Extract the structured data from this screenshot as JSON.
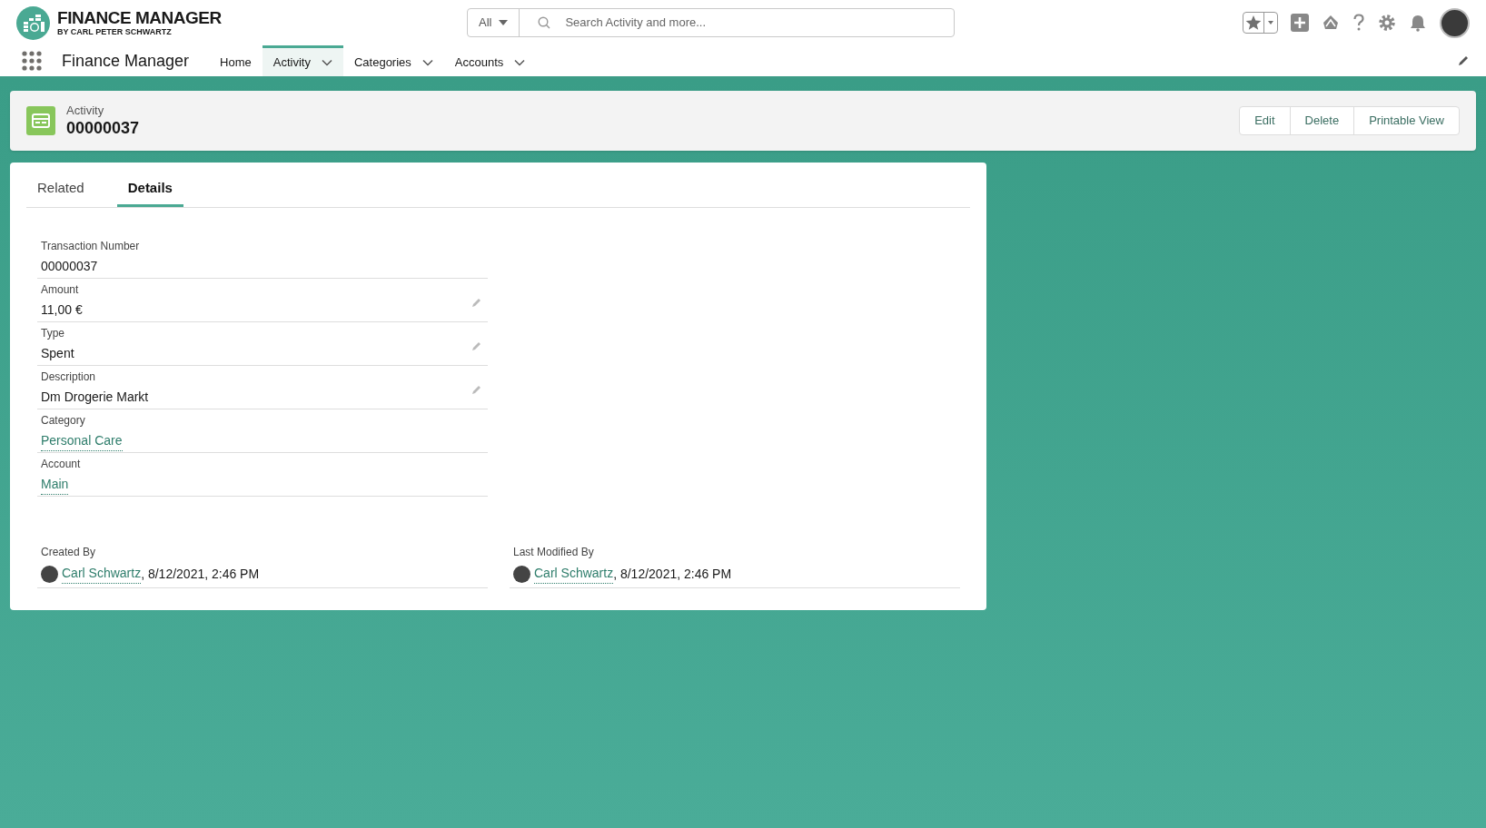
{
  "brand": {
    "title": "FINANCE MANAGER",
    "subtitle": "BY CARL PETER SCHWARTZ"
  },
  "search": {
    "scope": "All",
    "placeholder": "Search Activity and more..."
  },
  "nav": {
    "app_name": "Finance Manager",
    "items": [
      {
        "label": "Home",
        "selected": false,
        "has_menu": false
      },
      {
        "label": "Activity",
        "selected": true,
        "has_menu": true
      },
      {
        "label": "Categories",
        "selected": false,
        "has_menu": true
      },
      {
        "label": "Accounts",
        "selected": false,
        "has_menu": true
      }
    ]
  },
  "record": {
    "object_label": "Activity",
    "title": "00000037",
    "actions": [
      "Edit",
      "Delete",
      "Printable View"
    ]
  },
  "tabs": [
    {
      "label": "Related",
      "selected": false
    },
    {
      "label": "Details",
      "selected": true
    }
  ],
  "fields": [
    {
      "label": "Transaction Number",
      "value": "00000037",
      "kind": "text",
      "editable": false
    },
    {
      "label": "Amount",
      "value": "11,00 €",
      "kind": "text",
      "editable": true
    },
    {
      "label": "Type",
      "value": "Spent",
      "kind": "text",
      "editable": true
    },
    {
      "label": "Description",
      "value": "Dm Drogerie Markt",
      "kind": "text",
      "editable": true
    },
    {
      "label": "Category",
      "value": "Personal Care",
      "kind": "link",
      "editable": false
    },
    {
      "label": "Account",
      "value": "Main",
      "kind": "link",
      "editable": false
    }
  ],
  "system_fields": [
    {
      "label": "Created By",
      "user": "Carl Schwartz",
      "timestamp": ", 8/12/2021, 2:46 PM"
    },
    {
      "label": "Last Modified By",
      "user": "Carl Schwartz",
      "timestamp": ", 8/12/2021, 2:46 PM"
    }
  ]
}
